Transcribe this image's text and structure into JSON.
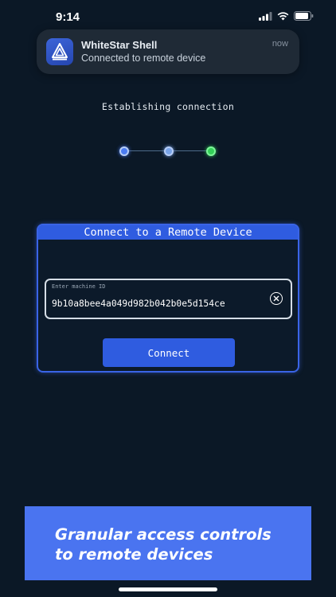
{
  "status_bar": {
    "time": "9:14"
  },
  "notification": {
    "app_name": "WhiteStar Shell",
    "message": "Connected to remote device",
    "time": "now"
  },
  "connection": {
    "status_text": "Establishing connection",
    "steps": [
      {
        "color": "#4a7bf2"
      },
      {
        "color": "#79a4e8"
      },
      {
        "color": "#34d058"
      }
    ]
  },
  "panel": {
    "title": "Connect to a Remote Device",
    "machine_id_label": "Enter machine ID",
    "machine_id_value": "9b10a8bee4a049d982b042b0e5d154ce",
    "connect_label": "Connect"
  },
  "promo": {
    "line1": "Granular access controls",
    "line2": "to remote devices"
  },
  "colors": {
    "background": "#0b1826",
    "accent": "#2f5ce0",
    "promo": "#4a74f0"
  }
}
